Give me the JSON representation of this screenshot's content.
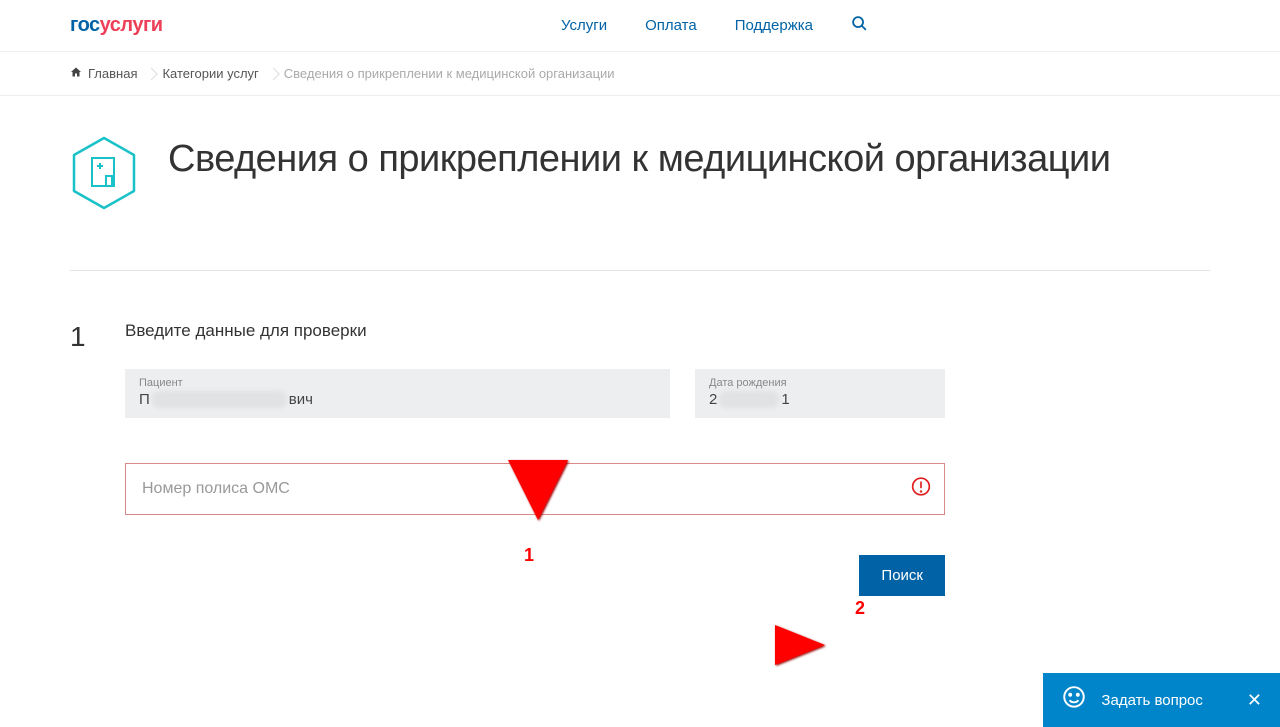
{
  "nav": {
    "logo_blue1": "гос",
    "logo_red": "услуги",
    "services": "Услуги",
    "payment": "Оплата",
    "support": "Поддержка"
  },
  "breadcrumbs": {
    "home": "Главная",
    "categories": "Категории услуг",
    "current": "Сведения о прикреплении к медицинской организации"
  },
  "page": {
    "title": "Сведения о прикреплении к медицинской организации"
  },
  "step": {
    "number": "1",
    "title": "Введите данные для проверки",
    "patient_label": "Пациент",
    "patient_prefix": "П",
    "patient_suffix": "вич",
    "dob_label": "Дата рождения",
    "dob_prefix": "2",
    "dob_suffix": "1",
    "oms_placeholder": "Номер полиса ОМС",
    "search_btn": "Поиск"
  },
  "annotations": {
    "n1": "1",
    "n2": "2"
  },
  "widget": {
    "ask": "Задать вопрос"
  }
}
